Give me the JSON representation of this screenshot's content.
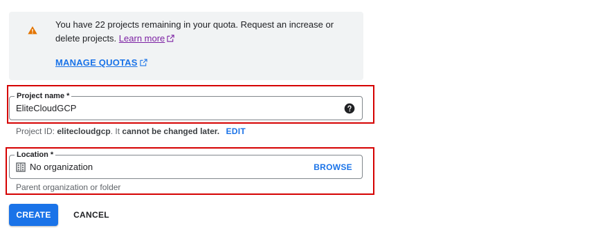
{
  "quota_notice": {
    "message": "You have 22 projects remaining in your quota. Request an increase or delete projects.",
    "learn_more": "Learn more",
    "manage_quotas": "MANAGE QUOTAS",
    "warning_icon": "warning-triangle-icon",
    "warning_color": "#e37400"
  },
  "project_name": {
    "label": "Project name *",
    "value": "EliteCloudGCP",
    "help_icon": "help-circle-icon"
  },
  "project_id": {
    "prefix": "Project ID:",
    "id": "elitecloudgcp",
    "suffix": ". It",
    "cannot_change": "cannot be changed later.",
    "edit_label": "EDIT"
  },
  "location": {
    "label": "Location *",
    "value": "No organization",
    "browse_label": "BROWSE",
    "helper": "Parent organization or folder",
    "icon": "building-icon"
  },
  "actions": {
    "create_label": "CREATE",
    "cancel_label": "CANCEL"
  },
  "colors": {
    "accent": "#1a73e8",
    "highlight": "#d50000",
    "link_visited": "#7b1fa2"
  }
}
